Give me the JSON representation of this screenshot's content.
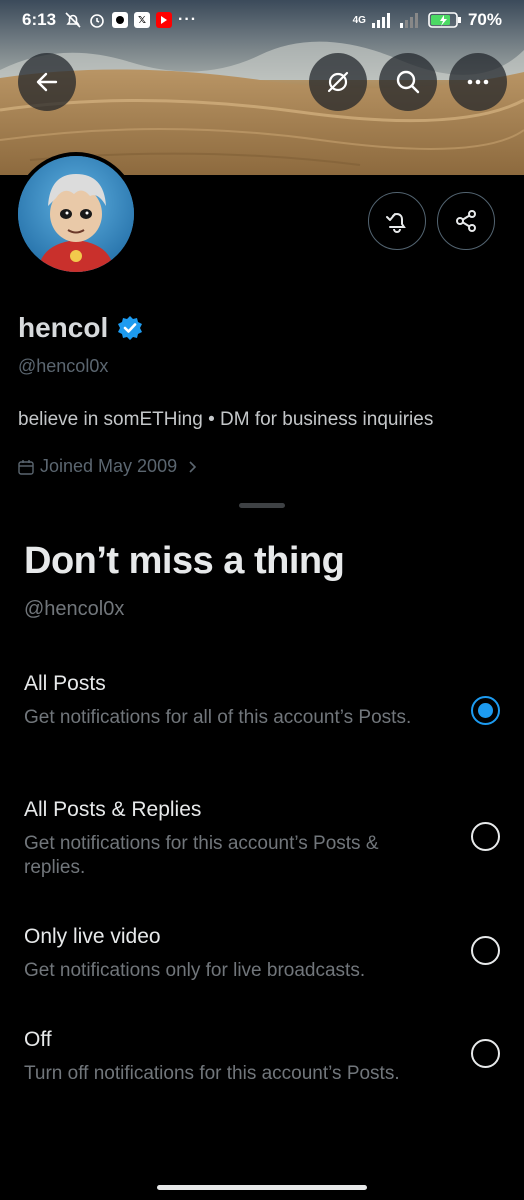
{
  "status_bar": {
    "time": "6:13",
    "network": "4G",
    "battery": "70%"
  },
  "profile": {
    "name": "hencol",
    "handle": "@hencol0x",
    "bio": "believe in somETHing • DM for business inquiries",
    "joined": "Joined May 2009",
    "verified_color": "#1d9bf0"
  },
  "sheet": {
    "title": "Don’t miss a thing",
    "handle": "@hencol0x",
    "options": [
      {
        "title": "All Posts",
        "description": "Get notifications for all of this account’s Posts.",
        "selected": true
      },
      {
        "title": "All Posts & Replies",
        "description": "Get notifications for this account’s Posts & replies.",
        "selected": false
      },
      {
        "title": "Only live video",
        "description": "Get notifications only for live broadcasts.",
        "selected": false
      },
      {
        "title": "Off",
        "description": "Turn off notifications for this account’s Posts.",
        "selected": false
      }
    ]
  },
  "icons": {
    "back": "arrow-left-icon",
    "grok": "grok-icon",
    "search": "search-icon",
    "more": "more-icon",
    "notify": "bell-check-icon",
    "share": "share-icon",
    "calendar": "calendar-icon"
  },
  "colors": {
    "accent": "#1d9bf0",
    "background": "#000000",
    "secondary_text": "#71767b"
  }
}
